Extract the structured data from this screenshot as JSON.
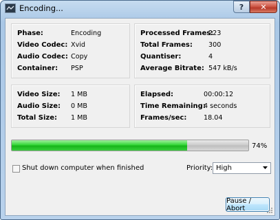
{
  "window": {
    "title": "Encoding..."
  },
  "titlebar": {
    "help_label": "?",
    "close_label": "✕"
  },
  "info": {
    "phase": {
      "label": "Phase:",
      "value": "Encoding"
    },
    "video_codec": {
      "label": "Video Codec:",
      "value": "Xvid"
    },
    "audio_codec": {
      "label": "Audio Codec:",
      "value": "Copy"
    },
    "container": {
      "label": "Container:",
      "value": "PSP"
    }
  },
  "stats": {
    "processed_frames": {
      "label": "Processed Frames:",
      "value": "223"
    },
    "total_frames": {
      "label": "Total Frames:",
      "value": "300"
    },
    "quantiser": {
      "label": "Quantiser:",
      "value": "4"
    },
    "average_bitrate": {
      "label": "Average Bitrate:",
      "value": "547 kB/s"
    }
  },
  "sizes": {
    "video_size": {
      "label": "Video Size:",
      "value": "1 MB"
    },
    "audio_size": {
      "label": "Audio Size:",
      "value": "0 MB"
    },
    "total_size": {
      "label": "Total Size:",
      "value": "1 MB"
    }
  },
  "timing": {
    "elapsed": {
      "label": "Elapsed:",
      "value": "00:00:12"
    },
    "time_remaining": {
      "label": "Time Remaining:",
      "value": "4 seconds"
    },
    "frames_per_sec": {
      "label": "Frames/sec:",
      "value": "18.04"
    }
  },
  "progress": {
    "percent": 74,
    "label": "74%"
  },
  "shutdown": {
    "label": "Shut down computer when finished",
    "checked": false
  },
  "priority": {
    "label": "Priority:",
    "value": "High"
  },
  "actions": {
    "pause_abort": "Pause / Abort"
  },
  "colors": {
    "progress_fill": "#22c025",
    "accent_border": "#3c7fb1",
    "close_red": "#c8473a"
  }
}
